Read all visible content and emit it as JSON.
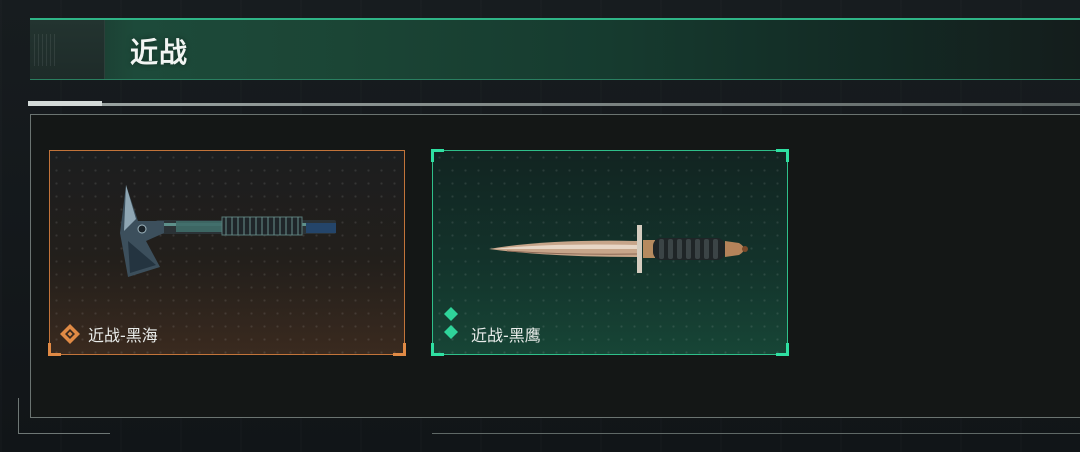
{
  "header": {
    "title": "近战"
  },
  "colors": {
    "accent_green": "#2fbf8a",
    "accent_orange": "#c2743a",
    "header_green": "#1d4a3a"
  },
  "items": [
    {
      "label": "近战-黑海",
      "rarity_icon": "orange-diamond-cluster-icon",
      "weapon_icon": "tomahawk-axe-icon",
      "rarity_color": "#e08a45"
    },
    {
      "label": "近战-黑鹰",
      "rarity_icon": "green-double-diamond-icon",
      "weapon_icon": "combat-knife-icon",
      "rarity_color": "#2fd49a"
    }
  ]
}
